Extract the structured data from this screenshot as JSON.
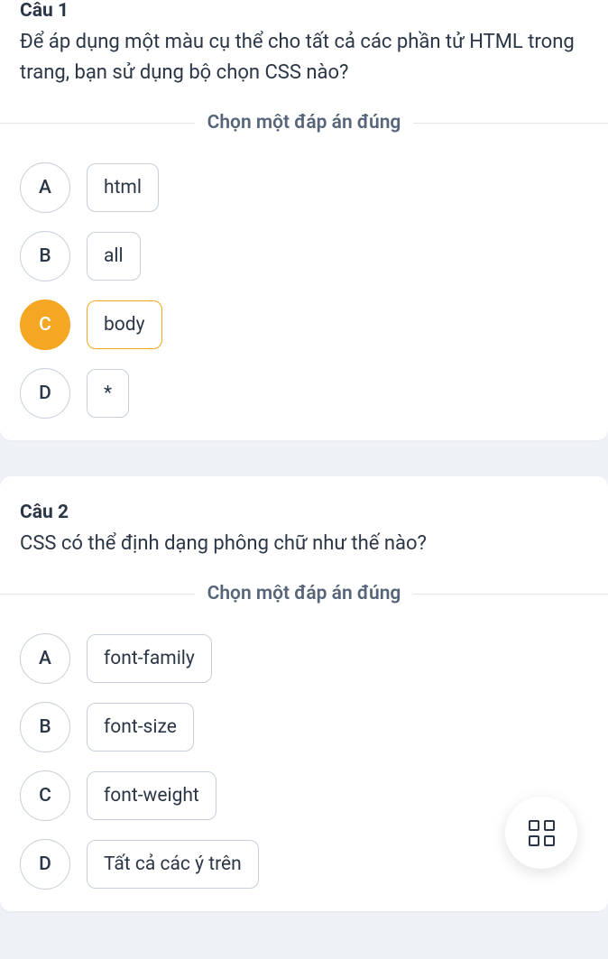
{
  "instruction": "Chọn một đáp án đúng",
  "questions": [
    {
      "title": "Câu 1",
      "text": "Để áp dụng một màu cụ thể cho tất cả các phần tử HTML trong trang, bạn sử dụng bộ chọn CSS nào?",
      "selected": "C",
      "options": [
        {
          "letter": "A",
          "label": "html"
        },
        {
          "letter": "B",
          "label": "all"
        },
        {
          "letter": "C",
          "label": "body"
        },
        {
          "letter": "D",
          "label": "*"
        }
      ]
    },
    {
      "title": "Câu 2",
      "text": "CSS có thể định dạng phông chữ như thế nào?",
      "selected": null,
      "options": [
        {
          "letter": "A",
          "label": "font-family"
        },
        {
          "letter": "B",
          "label": "font-size"
        },
        {
          "letter": "C",
          "label": "font-weight"
        },
        {
          "letter": "D",
          "label": "Tất cả các ý trên"
        }
      ]
    }
  ]
}
